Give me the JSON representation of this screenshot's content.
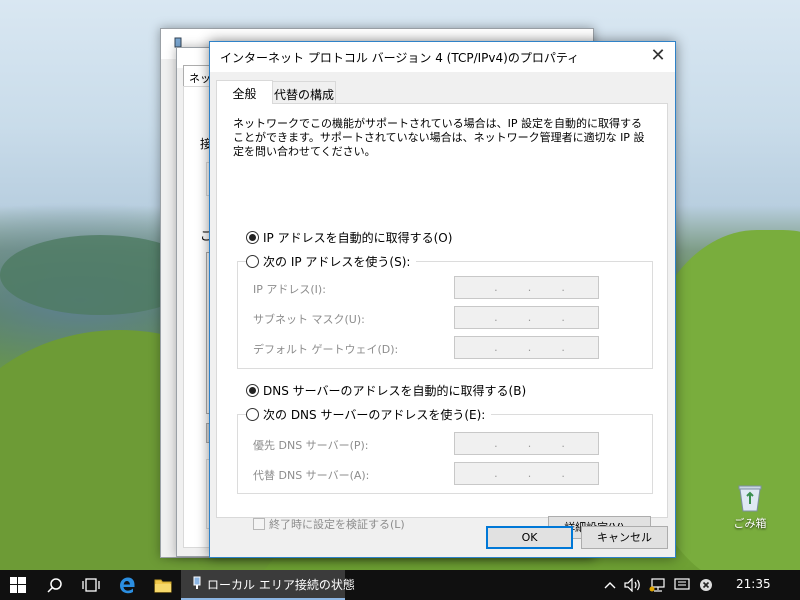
{
  "dialog": {
    "title": "インターネット プロトコル バージョン 4 (TCP/IPv4)のプロパティ",
    "close_glyph": "✕",
    "tabs": [
      {
        "label": "全般"
      },
      {
        "label": "代替の構成"
      }
    ],
    "description": "ネットワークでこの機能がサポートされている場合は、IP 設定を自動的に取得することができます。サポートされていない場合は、ネットワーク管理者に適切な IP 設定を問い合わせてください。",
    "ip_auto_label": "IP アドレスを自動的に取得する(O)",
    "ip_manual_label": "次の IP アドレスを使う(S):",
    "ip_address_label": "IP アドレス(I):",
    "subnet_label": "サブネット マスク(U):",
    "gateway_label": "デフォルト ゲートウェイ(D):",
    "dns_auto_label": "DNS サーバーのアドレスを自動的に取得する(B)",
    "dns_manual_label": "次の DNS サーバーのアドレスを使う(E):",
    "dns_preferred_label": "優先 DNS サーバー(P):",
    "dns_alternate_label": "代替 DNS サーバー(A):",
    "ip_dot": ".",
    "validate_label": "終了時に設定を検証する(L)",
    "advanced_button": "詳細設定(V)...",
    "ok_button": "OK",
    "cancel_button": "キャンセル",
    "ip_auto_selected": true,
    "dns_auto_selected": true,
    "validate_checked": false
  },
  "background_window": {
    "tab_stub": "ネット",
    "text_stub_1": "接",
    "text_stub_2": "こ"
  },
  "desktop": {
    "recycle_bin_label": "ごみ箱"
  },
  "taskbar": {
    "app_label": "ローカル エリア接続の状態",
    "clock": "21:35"
  },
  "colors": {
    "accent": "#0078d7",
    "taskbar": "#101010"
  }
}
